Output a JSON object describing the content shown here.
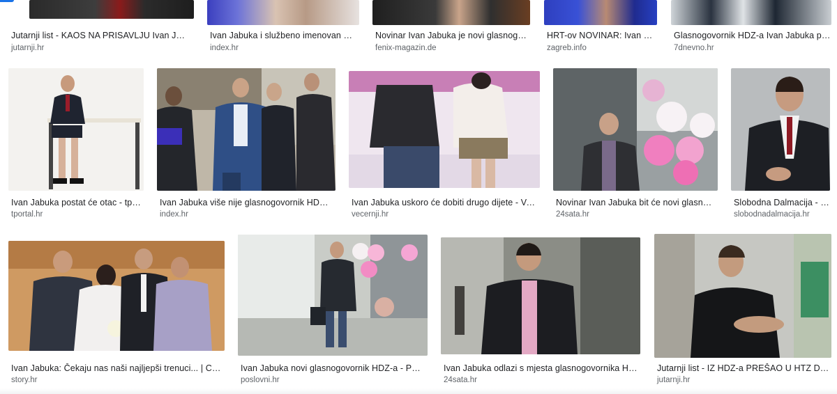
{
  "results": [
    {
      "title": "Jutarnji list - KAOS NA PRISAVLJU Ivan Jabuka",
      "source": "jutarnji.hr"
    },
    {
      "title": "Ivan Jabuka i službeno imenovan glasnogovornikom",
      "source": "index.hr"
    },
    {
      "title": "Novinar Ivan Jabuka je novi glasnogovornik",
      "source": "fenix-magazin.de"
    },
    {
      "title": "HRT-ov NOVINAR: Ivan Jabuka",
      "source": "zagreb.info"
    },
    {
      "title": "Glasnogovornik HDZ-a Ivan Jabuka postaje",
      "source": "7dnevno.hr"
    },
    {
      "title": "Ivan Jabuka postat će otac - tportal",
      "source": "tportal.hr"
    },
    {
      "title": "Ivan Jabuka više nije glasnogovornik HDZ-a",
      "source": "index.hr"
    },
    {
      "title": "Ivan Jabuka uskoro će dobiti drugo dijete - Večernji",
      "source": "vecernji.hr"
    },
    {
      "title": "Novinar Ivan Jabuka bit će novi glasnogovornik",
      "source": "24sata.hr"
    },
    {
      "title": "Slobodna Dalmacija - Ivan Jabuka",
      "source": "slobodnadalmacija.hr"
    },
    {
      "title": "Ivan Jabuka: Čekaju nas naši najljepši trenuci... | Celebrity",
      "source": "story.hr"
    },
    {
      "title": "Ivan Jabuka novi glasnogovornik HDZ-a - Poslovni",
      "source": "poslovni.hr"
    },
    {
      "title": "Ivan Jabuka odlazi s mjesta glasnogovornika HDZ-a",
      "source": "24sata.hr"
    },
    {
      "title": "Jutarnji list - IZ HDZ-a PREŠAO U HTZ Donosimo",
      "source": "jutarnji.hr"
    }
  ],
  "colors": {
    "accent": "#1a73e8",
    "title": "#202124",
    "source": "#5f6368"
  }
}
